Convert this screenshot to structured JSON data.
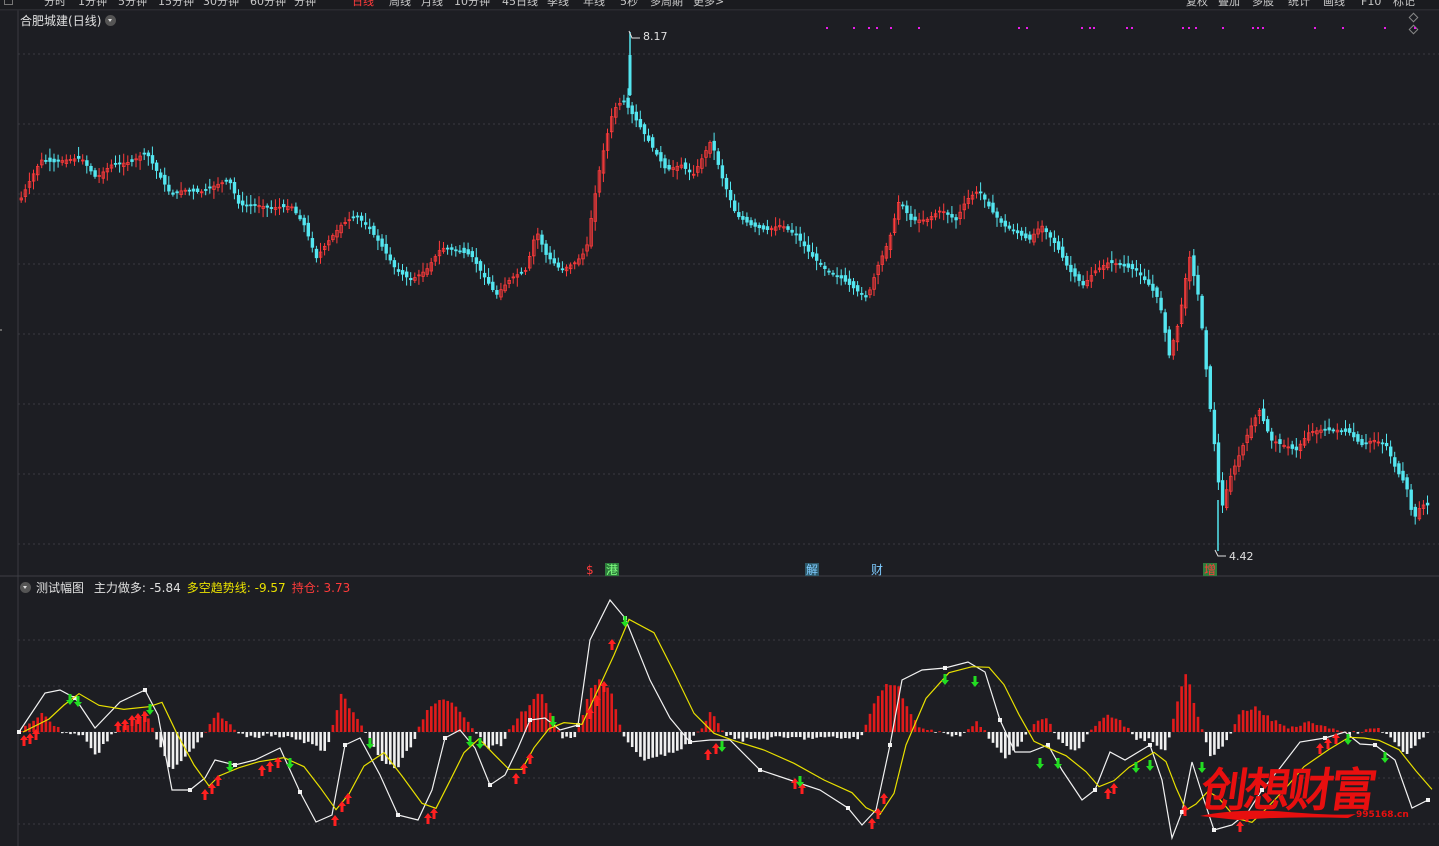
{
  "toolbar": {
    "periods": [
      "分时",
      "1分钟",
      "5分钟",
      "15分钟",
      "30分钟",
      "60分钟",
      "分钟",
      "日线",
      "周线",
      "月线",
      "10分钟",
      "45日线",
      "季线",
      "年线",
      "5秒",
      "多周期",
      "更多>"
    ],
    "active_period": "日线",
    "actions": [
      "复权",
      "叠加",
      "多股",
      "统计",
      "画线",
      "F10",
      "标记"
    ]
  },
  "main_chart": {
    "stock_name": "合肥城建",
    "period_label": "(日线)",
    "high_label": "8.17",
    "low_label": "4.42",
    "event_markers": [
      {
        "text": "$",
        "color": "#ff3b3b"
      },
      {
        "text": "港",
        "color": "#7fff7f"
      },
      {
        "text": "解",
        "color": "#7ecbff"
      },
      {
        "text": "财",
        "color": "#7ecbff"
      },
      {
        "text": "增",
        "color": "#ff3b3b"
      }
    ],
    "up_color": "#ff3b3b",
    "down_color": "#54e6f0"
  },
  "sub_chart": {
    "name": "测试幅图",
    "series": [
      {
        "label": "主力做多:",
        "value": "-5.84",
        "color": "#e0e0e0"
      },
      {
        "label": "多空趋势线:",
        "value": "-9.57",
        "color": "#e8e000"
      },
      {
        "label": "持仓:",
        "value": "3.73",
        "color": "#ff3b3b"
      }
    ]
  },
  "watermark": {
    "text": "创想财富",
    "url": "995168.cn"
  }
}
